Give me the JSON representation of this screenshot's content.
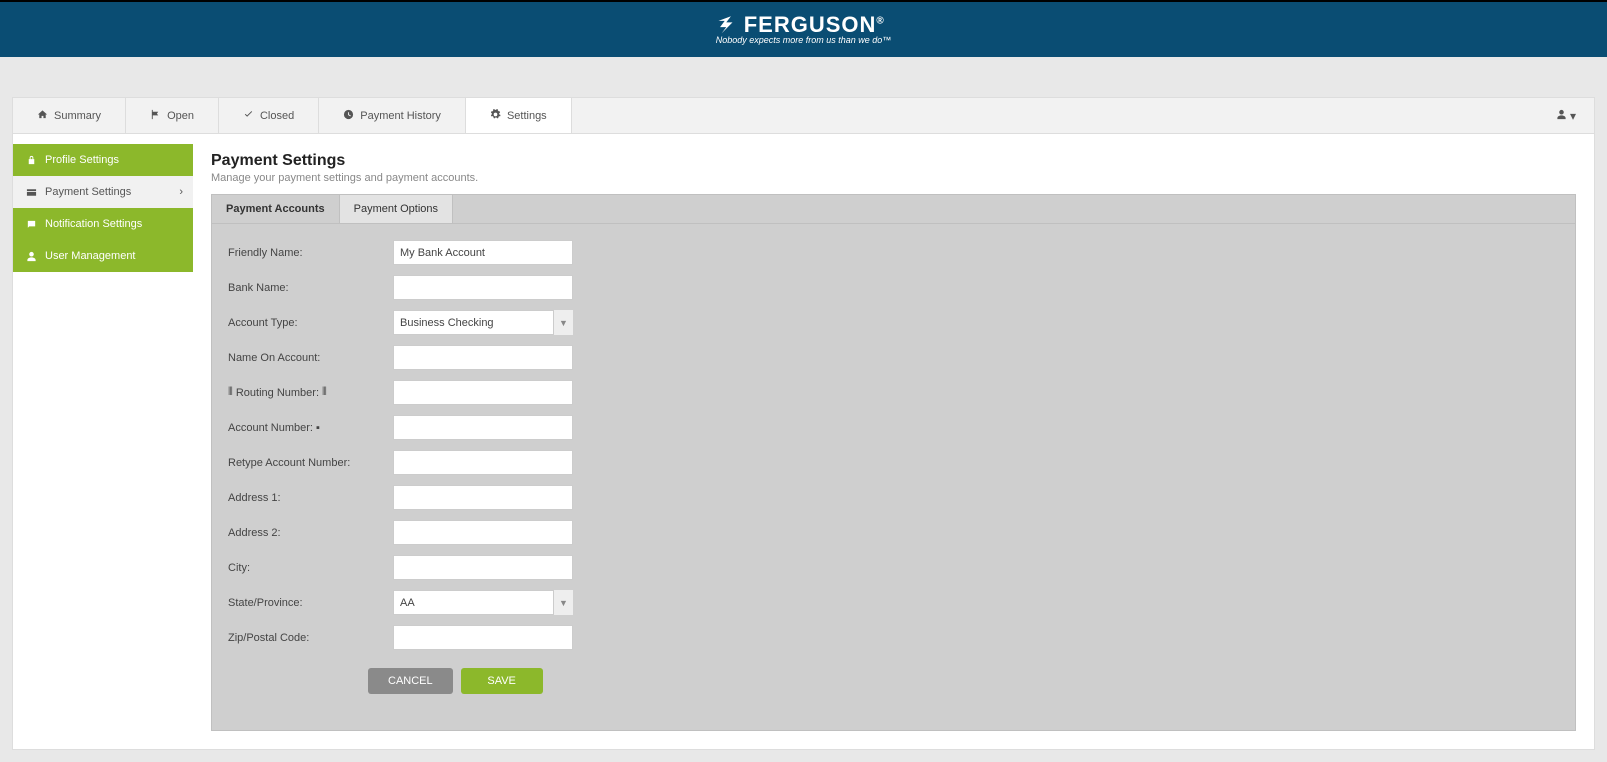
{
  "brand": {
    "name": "FERGUSON",
    "tagline": "Nobody expects more from us than we do™"
  },
  "topTabs": {
    "summary": "Summary",
    "open": "Open",
    "closed": "Closed",
    "paymentHistory": "Payment History",
    "settings": "Settings"
  },
  "sidebar": {
    "profile": "Profile Settings",
    "payment": "Payment Settings",
    "notification": "Notification Settings",
    "userMgmt": "User Management"
  },
  "page": {
    "title": "Payment Settings",
    "subtitle": "Manage your payment settings and payment accounts."
  },
  "innerTabs": {
    "accounts": "Payment Accounts",
    "options": "Payment Options"
  },
  "form": {
    "friendlyName": {
      "label": "Friendly Name:",
      "value": "My Bank Account"
    },
    "bankName": {
      "label": "Bank Name:",
      "value": ""
    },
    "accountType": {
      "label": "Account Type:",
      "value": "Business Checking"
    },
    "nameOnAccount": {
      "label": "Name On Account:",
      "value": ""
    },
    "routingNumber": {
      "label": "Routing Number:",
      "value": ""
    },
    "accountNumber": {
      "label": "Account Number:",
      "value": ""
    },
    "retypeAccountNumber": {
      "label": "Retype Account Number:",
      "value": ""
    },
    "address1": {
      "label": "Address 1:",
      "value": ""
    },
    "address2": {
      "label": "Address 2:",
      "value": ""
    },
    "city": {
      "label": "City:",
      "value": ""
    },
    "stateProvince": {
      "label": "State/Province:",
      "value": "AA"
    },
    "zip": {
      "label": "Zip/Postal Code:",
      "value": ""
    }
  },
  "buttons": {
    "cancel": "CANCEL",
    "save": "SAVE"
  }
}
